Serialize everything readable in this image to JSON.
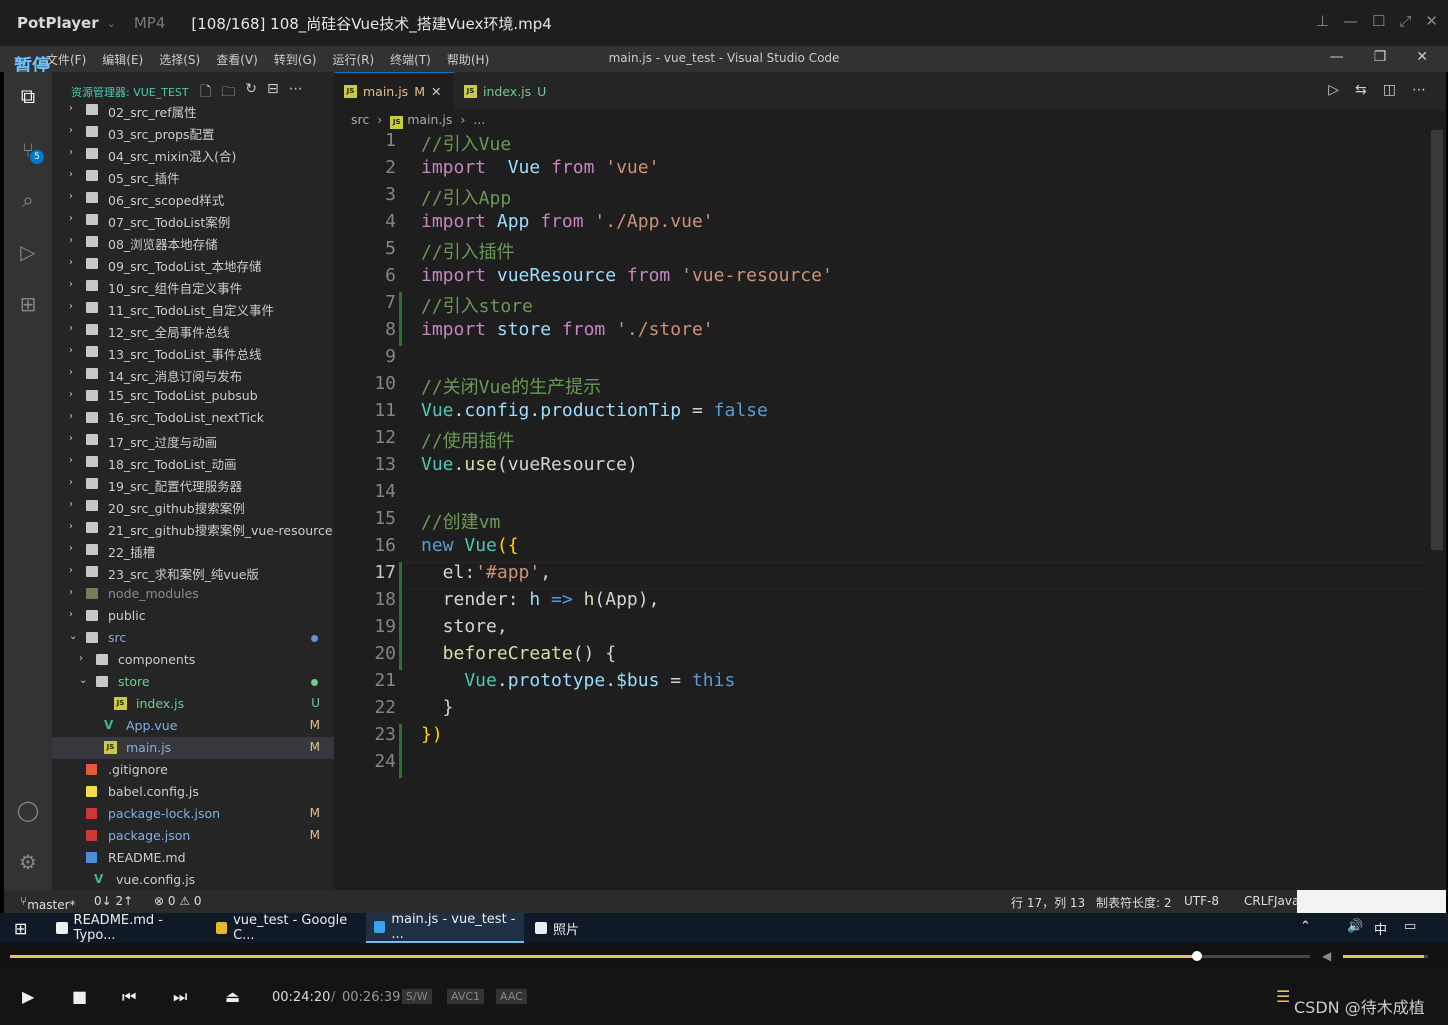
{
  "player": {
    "app_name": "PotPlayer",
    "format": "MP4",
    "file_title": "[108/168] 108_尚硅谷Vue技术_搭建Vuex环境.mp4",
    "pause_label": "暂停",
    "current_time": "00:24:20",
    "separator": "/",
    "total_time": "00:26:39",
    "badges": [
      "S/W",
      "AVC1",
      "AAC"
    ],
    "progress_fraction": 0.913,
    "volume_fraction": 0.95,
    "watermark": "CSDN @待木成植"
  },
  "vscode": {
    "title": "main.js - vue_test - Visual Studio Code",
    "menu": [
      "文件(F)",
      "编辑(E)",
      "选择(S)",
      "查看(V)",
      "转到(G)",
      "运行(R)",
      "终端(T)",
      "帮助(H)"
    ],
    "explorer_title": "资源管理器: VUE_TEST",
    "scm_badge": "5",
    "tree": [
      {
        "label": "02_src_ref属性",
        "kind": "folder",
        "indent": 0
      },
      {
        "label": "03_src_props配置",
        "kind": "folder",
        "indent": 0
      },
      {
        "label": "04_src_mixin混入(合)",
        "kind": "folder",
        "indent": 0
      },
      {
        "label": "05_src_插件",
        "kind": "folder",
        "indent": 0
      },
      {
        "label": "06_src_scoped样式",
        "kind": "folder",
        "indent": 0
      },
      {
        "label": "07_src_TodoList案例",
        "kind": "folder",
        "indent": 0
      },
      {
        "label": "08_浏览器本地存储",
        "kind": "folder",
        "indent": 0
      },
      {
        "label": "09_src_TodoList_本地存储",
        "kind": "folder",
        "indent": 0
      },
      {
        "label": "10_src_组件自定义事件",
        "kind": "folder",
        "indent": 0
      },
      {
        "label": "11_src_TodoList_自定义事件",
        "kind": "folder",
        "indent": 0
      },
      {
        "label": "12_src_全局事件总线",
        "kind": "folder",
        "indent": 0
      },
      {
        "label": "13_src_TodoList_事件总线",
        "kind": "folder",
        "indent": 0
      },
      {
        "label": "14_src_消息订阅与发布",
        "kind": "folder",
        "indent": 0
      },
      {
        "label": "15_src_TodoList_pubsub",
        "kind": "folder",
        "indent": 0
      },
      {
        "label": "16_src_TodoList_nextTick",
        "kind": "folder",
        "indent": 0
      },
      {
        "label": "17_src_过度与动画",
        "kind": "folder",
        "indent": 0
      },
      {
        "label": "18_src_TodoList_动画",
        "kind": "folder",
        "indent": 0
      },
      {
        "label": "19_src_配置代理服务器",
        "kind": "folder",
        "indent": 0
      },
      {
        "label": "20_src_github搜索案例",
        "kind": "folder",
        "indent": 0
      },
      {
        "label": "21_src_github搜索案例_vue-resource",
        "kind": "folder",
        "indent": 0
      },
      {
        "label": "22_插槽",
        "kind": "folder",
        "indent": 0
      },
      {
        "label": "23_src_求和案例_纯vue版",
        "kind": "folder",
        "indent": 0
      },
      {
        "label": "node_modules",
        "kind": "folder-dim",
        "indent": 0
      },
      {
        "label": "public",
        "kind": "folder",
        "indent": 0
      },
      {
        "label": "src",
        "kind": "folder-open",
        "indent": 0,
        "status": "dot"
      },
      {
        "label": "components",
        "kind": "folder",
        "indent": 1
      },
      {
        "label": "store",
        "kind": "folder-open",
        "indent": 1,
        "status": "dot"
      },
      {
        "label": "index.js",
        "kind": "js",
        "indent": 2,
        "status": "U"
      },
      {
        "label": "App.vue",
        "kind": "vue",
        "indent": 1,
        "status": "M"
      },
      {
        "label": "main.js",
        "kind": "js",
        "indent": 1,
        "status": "M",
        "selected": true
      },
      {
        "label": ".gitignore",
        "kind": "git",
        "indent": 0
      },
      {
        "label": "babel.config.js",
        "kind": "babel",
        "indent": 0
      },
      {
        "label": "package-lock.json",
        "kind": "npm",
        "indent": 0,
        "status": "M"
      },
      {
        "label": "package.json",
        "kind": "npm",
        "indent": 0,
        "status": "M"
      },
      {
        "label": "README.md",
        "kind": "md",
        "indent": 0
      },
      {
        "label": "vue.config.js",
        "kind": "vue",
        "indent": 0
      }
    ],
    "tabs": [
      {
        "label": "main.js",
        "status": "M",
        "active": true
      },
      {
        "label": "index.js",
        "status": "U",
        "active": false
      }
    ],
    "breadcrumb": [
      "src",
      "main.js",
      "..."
    ],
    "current_line": 17,
    "code_lines": [
      [
        [
          "c",
          "//引入Vue"
        ]
      ],
      [
        [
          "k",
          "import"
        ],
        [
          "",
          "  "
        ],
        [
          "p",
          "Vue"
        ],
        [
          "",
          ""
        ],
        [
          "k",
          " from"
        ],
        [
          "s",
          " 'vue'"
        ]
      ],
      [
        [
          "c",
          "//引入App"
        ]
      ],
      [
        [
          "k",
          "import"
        ],
        [
          "p",
          " App"
        ],
        [
          "k",
          " from"
        ],
        [
          "s",
          " './App.vue'"
        ]
      ],
      [
        [
          "c",
          "//引入插件"
        ]
      ],
      [
        [
          "k",
          "import"
        ],
        [
          "p",
          " vueResource"
        ],
        [
          "k",
          " from"
        ],
        [
          "s",
          " 'vue-resource'"
        ]
      ],
      [
        [
          "c",
          "//引入store"
        ]
      ],
      [
        [
          "k",
          "import"
        ],
        [
          "p",
          " store"
        ],
        [
          "k",
          " from"
        ],
        [
          "s",
          " './store'"
        ]
      ],
      [
        [
          "",
          ""
        ]
      ],
      [
        [
          "c",
          "//关闭Vue的生产提示"
        ]
      ],
      [
        [
          "t",
          "Vue"
        ],
        [
          "",
          "."
        ],
        [
          "p",
          "config"
        ],
        [
          "",
          "."
        ],
        [
          "p",
          "productionTip"
        ],
        [
          "",
          " = "
        ],
        [
          "kb",
          "false"
        ]
      ],
      [
        [
          "c",
          "//使用插件"
        ]
      ],
      [
        [
          "t",
          "Vue"
        ],
        [
          "",
          "."
        ],
        [
          "f",
          "use"
        ],
        [
          "",
          "(vueResource)"
        ]
      ],
      [
        [
          "",
          ""
        ]
      ],
      [
        [
          "c",
          "//创建vm"
        ]
      ],
      [
        [
          "kb",
          "new"
        ],
        [
          "t",
          " Vue"
        ],
        [
          "y",
          "({"
        ]
      ],
      [
        [
          "",
          "  el:"
        ],
        [
          "s",
          "'#app'"
        ],
        [
          "",
          ","
        ]
      ],
      [
        [
          "",
          "  render: "
        ],
        [
          "p",
          "h"
        ],
        [
          "kb",
          " =>"
        ],
        [
          "f",
          " h"
        ],
        [
          "",
          "(App),"
        ]
      ],
      [
        [
          "",
          "  store,"
        ]
      ],
      [
        [
          "f",
          "  beforeCreate"
        ],
        [
          "",
          "() {"
        ]
      ],
      [
        [
          "t",
          "    Vue"
        ],
        [
          "",
          "."
        ],
        [
          "p",
          "prototype"
        ],
        [
          "",
          "."
        ],
        [
          "p",
          "$bus"
        ],
        [
          "",
          " = "
        ],
        [
          "kb",
          "this"
        ]
      ],
      [
        [
          "",
          "  }"
        ]
      ],
      [
        [
          "y",
          "})"
        ]
      ],
      [
        [
          "",
          ""
        ]
      ]
    ],
    "status": {
      "branch": "master*",
      "sync": "0↓ 2↑",
      "problems": "⊗ 0 ⚠ 0",
      "position": "行 17，列 13",
      "tab_size": "制表符长度: 2",
      "encoding": "UTF-8",
      "eol": "CRLF",
      "language": "Java"
    }
  },
  "taskbar": {
    "items": [
      "README.md - Typo...",
      "vue_test - Google C...",
      "main.js - vue_test - ...",
      "照片"
    ],
    "active_index": 2,
    "ime": "中"
  },
  "colors": {
    "accent": "#007acc",
    "progress": "#e6c45a"
  }
}
